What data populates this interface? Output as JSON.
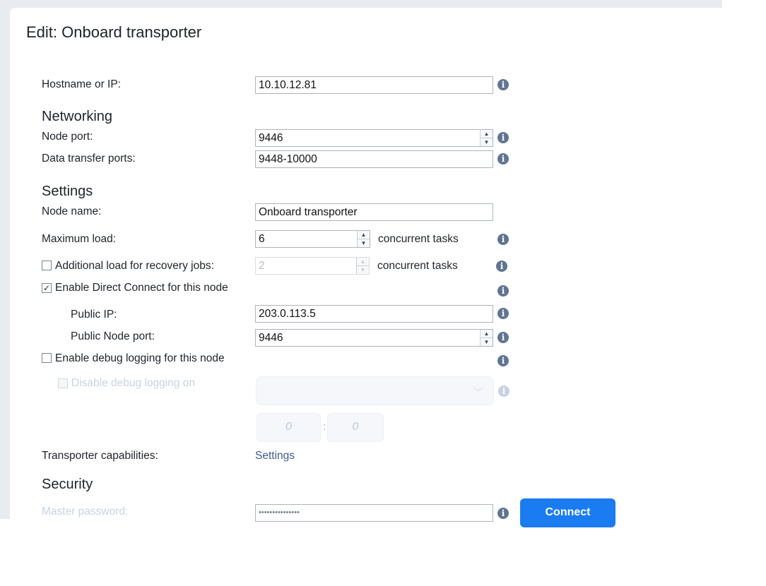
{
  "dialog": {
    "title": "Edit: Onboard transporter"
  },
  "hostname": {
    "label": "Hostname or IP:",
    "value": "10.10.12.81"
  },
  "networking": {
    "heading": "Networking",
    "node_port": {
      "label": "Node port:",
      "value": "9446"
    },
    "data_ports": {
      "label": "Data transfer ports:",
      "value": "9448-10000"
    }
  },
  "settings": {
    "heading": "Settings",
    "node_name": {
      "label": "Node name:",
      "value": "Onboard transporter"
    },
    "max_load": {
      "label": "Maximum load:",
      "value": "6",
      "suffix": "concurrent tasks"
    },
    "recovery_load": {
      "label": "Additional load for recovery jobs:",
      "value": "2",
      "suffix": "concurrent tasks",
      "checked": false
    },
    "direct_connect": {
      "label": "Enable Direct Connect for this node",
      "checked": true
    },
    "public_ip": {
      "label": "Public IP:",
      "value": "203.0.113.5"
    },
    "public_port": {
      "label": "Public Node port:",
      "value": "9446"
    },
    "debug_logging": {
      "label": "Enable debug logging for this node",
      "checked": false
    },
    "disable_debug": {
      "label": "Disable debug logging on",
      "checked": false,
      "hour": "0",
      "minute": "0",
      "separator": ":"
    },
    "capabilities": {
      "label": "Transporter capabilities:",
      "link": "Settings"
    }
  },
  "security": {
    "heading": "Security",
    "master_password": {
      "label": "Master password:",
      "value": "•••••••••••••••"
    },
    "connect_label": "Connect"
  },
  "icons": {
    "info": "i",
    "check": "✓",
    "spin_up": "▲",
    "spin_down": "▼",
    "chevron": "﹀"
  },
  "colors": {
    "accent": "#1a7cf0",
    "info": "#5f7592",
    "link": "#3c5e8c"
  }
}
